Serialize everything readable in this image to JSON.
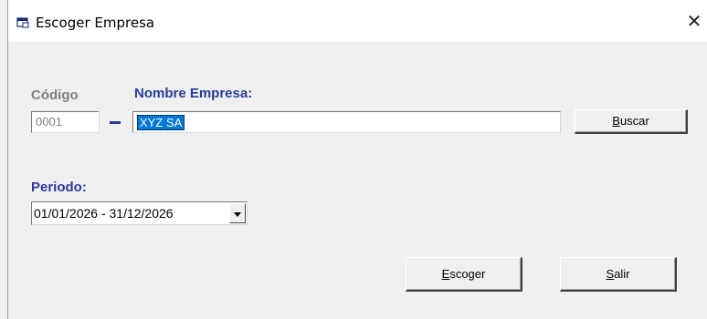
{
  "window": {
    "title": "Escoger Empresa",
    "close_glyph": "✕"
  },
  "form": {
    "codigo_label": "Código",
    "codigo_value": "0001",
    "nombre_label": "Nombre Empresa:",
    "nombre_value": "XYZ SA",
    "periodo_label": "Periodo:",
    "periodo_value": "01/01/2026 - 31/12/2026"
  },
  "buttons": {
    "buscar": {
      "mnemonic": "B",
      "rest": "uscar"
    },
    "escoger": {
      "mnemonic": "E",
      "rest": "scoger"
    },
    "salir": {
      "mnemonic": "S",
      "rest": "alir"
    }
  },
  "colors": {
    "label_blue": "#2a3a9a",
    "label_gray": "#808080",
    "selection": "#0078d7"
  },
  "icons": {
    "title": "window-app-icon",
    "combo": "chevron-down-icon",
    "close": "close-icon"
  }
}
